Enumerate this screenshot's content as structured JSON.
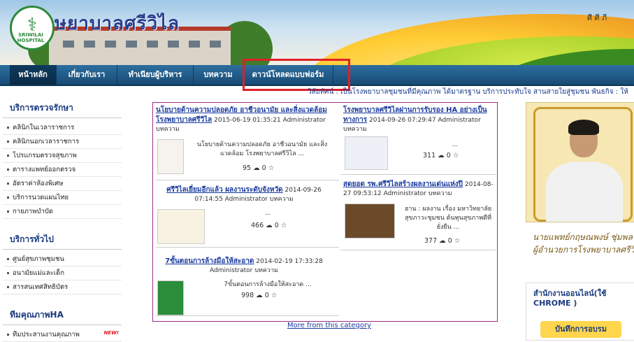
{
  "banner": {
    "title": "ษยาบาลศรีวิไล",
    "logo_text": "SRIWILAI HOSPITAL",
    "corner_text": "ศี ศี ภี",
    "logo_icon": "caduceus-icon"
  },
  "nav": {
    "items": [
      {
        "label": "หน้าหลัก",
        "active": true
      },
      {
        "label": "เกี่ยวกับเรา",
        "active": false
      },
      {
        "label": "ทำเนียบผู้บริหาร",
        "active": false
      },
      {
        "label": "บทความ",
        "active": false
      },
      {
        "label": "ดาวน์โหลดแบบฟอร์ม",
        "active": false
      }
    ],
    "highlight_color": "#e21f26"
  },
  "ticker": {
    "text": "วิสัยทัศน์ : เป็นโรงพยาบาลชุมชนที่มีคุณภาพ ได้มาตรฐาน บริการประทับใจ สานสายใยสู่ชุมชน          พันธกิจ : ให้"
  },
  "sidebar": {
    "section1": {
      "title": "บริการตรวจรักษา",
      "items": [
        "คลินิกในเวลาราชการ",
        "คลินิกนอกเวลาราชการ",
        "โปรแกรมตรวจสุขภาพ",
        "ตารางแพทย์ออกตรวจ",
        "อัตราค่าห้องพิเศษ",
        "บริการนวดแผนไทย",
        "กายภาพบำบัด"
      ]
    },
    "section2": {
      "title": "บริการทั่วไป",
      "items": [
        "ศูนย์สุขภาพชุมชน",
        "อนามัยแม่และเด็ก",
        "สารสนเทศสิทธิบัตร"
      ]
    },
    "section3": {
      "title": "ทีมคุณภาพHA",
      "items": [
        "ทีมประสานงานคุณภาพ"
      ],
      "new_badge": "NEW!"
    }
  },
  "articles": [
    {
      "title": "นโยบายด้านความปลอดภัย อาชีวอนามัย และสิ่งแวดล้อม โรงพยาบาลศรีวิไล",
      "meta": " 2015-06-19 01:35:21 Administrator บทความ",
      "intro": "นโยบายด้านความปลอดภัย อาชีวอนามัย และสิ่งแวดล้อม โรงพยาบาลศรีวิไล     ...",
      "views": "95",
      "comments": "0"
    },
    {
      "title": "โรงพยาบาลศรีวิไลผ่านการรับรอง HA อย่างเป็นทางการ",
      "meta": " 2014-09-26 07:29:47 Administrator บทความ",
      "intro": "...",
      "views": "311",
      "comments": "0"
    },
    {
      "title": "ศรีวิไลเยี่ยมอีกแล้ว ผลงานระดับจังหวัด",
      "meta": " 2014-09-26 07:14:55 Administrator บทความ",
      "intro": "...",
      "views": "466",
      "comments": "0"
    },
    {
      "title": "สุดยอด รพ.ศรีวิไลสร้างผลงานเด่นแห่งปี",
      "meta": " 2014-08-27 09:53:12 Administrator บทความ",
      "intro": "ฮาน : ผลงาน เรื่อง มหาวิทยาลัยสุขภาวะชุมชน ต้นทุนสุขภาพดีที่ยั่งยืน ...",
      "views": "377",
      "comments": "0"
    },
    {
      "title": "7ขั้นตอนการล้างมือให้สะอาด",
      "meta": " 2014-02-19 17:33:28 Administrator บทความ",
      "intro": "7ขั้นตอนการล้างมือให้สะอาด     ...",
      "views": "998",
      "comments": "0"
    }
  ],
  "more_link": "More from this category",
  "right": {
    "caption1": "นายแพทย์กฤษณพงษ์ ชุ่มพล",
    "caption2": "ผู้อำนวยการโรงพยาบาลศรีวิไล",
    "online_title": "สำนักงานออนไลน์(ใช้ CHROME )",
    "online_button": "บันทึกการอบรม"
  }
}
